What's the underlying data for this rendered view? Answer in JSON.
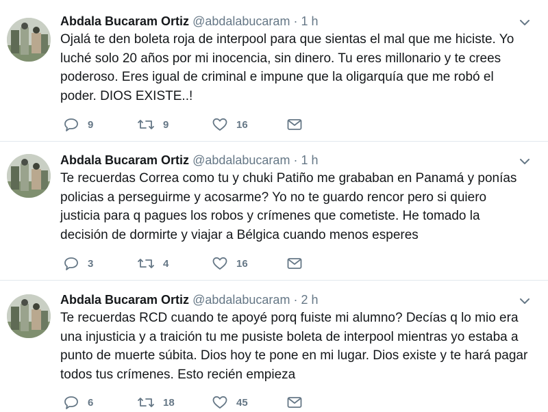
{
  "tweets": [
    {
      "name": "Abdala Bucaram Ortiz",
      "handle": "@abdalabucaram",
      "time": "1 h",
      "lines": [
        "Ojalá te den boleta roja de interpool para que sientas el mal que me hiciste. Yo",
        "luché solo 20 años por mi inocencia, sin dinero. Tu eres millonario y te crees",
        "poderoso. Eres igual de criminal e impune que la oligarquía que me robó el",
        "poder. DIOS EXISTE..!"
      ],
      "replies": "9",
      "retweets": "9",
      "likes": "16"
    },
    {
      "name": "Abdala Bucaram Ortiz",
      "handle": "@abdalabucaram",
      "time": "1 h",
      "lines": [
        "Te recuerdas Correa como tu y chuki Patiño me grababan en Panamá y ponías",
        "policias a perseguirme y acosarme? Yo no te guardo rencor pero si quiero",
        "justicia para q pagues los robos y crímenes que cometiste. He tomado la",
        "decisión de dormirte y viajar a Bélgica cuando menos esperes"
      ],
      "replies": "3",
      "retweets": "4",
      "likes": "16"
    },
    {
      "name": "Abdala Bucaram Ortiz",
      "handle": "@abdalabucaram",
      "time": "2 h",
      "lines": [
        "Te recuerdas RCD cuando te apoyé porq fuiste mi alumno? Decías q lo mio era",
        "una injusticia y a traición tu me pusiste boleta de interpool mientras yo estaba a",
        "punto de muerte súbita. Dios hoy te pone en mi lugar. Dios existe y te hará pagar",
        "todos tus crímenes. Esto recién empieza"
      ],
      "replies": "6",
      "retweets": "18",
      "likes": "45"
    }
  ],
  "separator": "·",
  "icons": {
    "reply": "reply-icon",
    "retweet": "retweet-icon",
    "like": "heart-icon",
    "message": "envelope-icon",
    "caret": "chevron-down-icon"
  },
  "colors": {
    "text": "#14171a",
    "secondary": "#657786",
    "divider": "#e1e8ed"
  }
}
